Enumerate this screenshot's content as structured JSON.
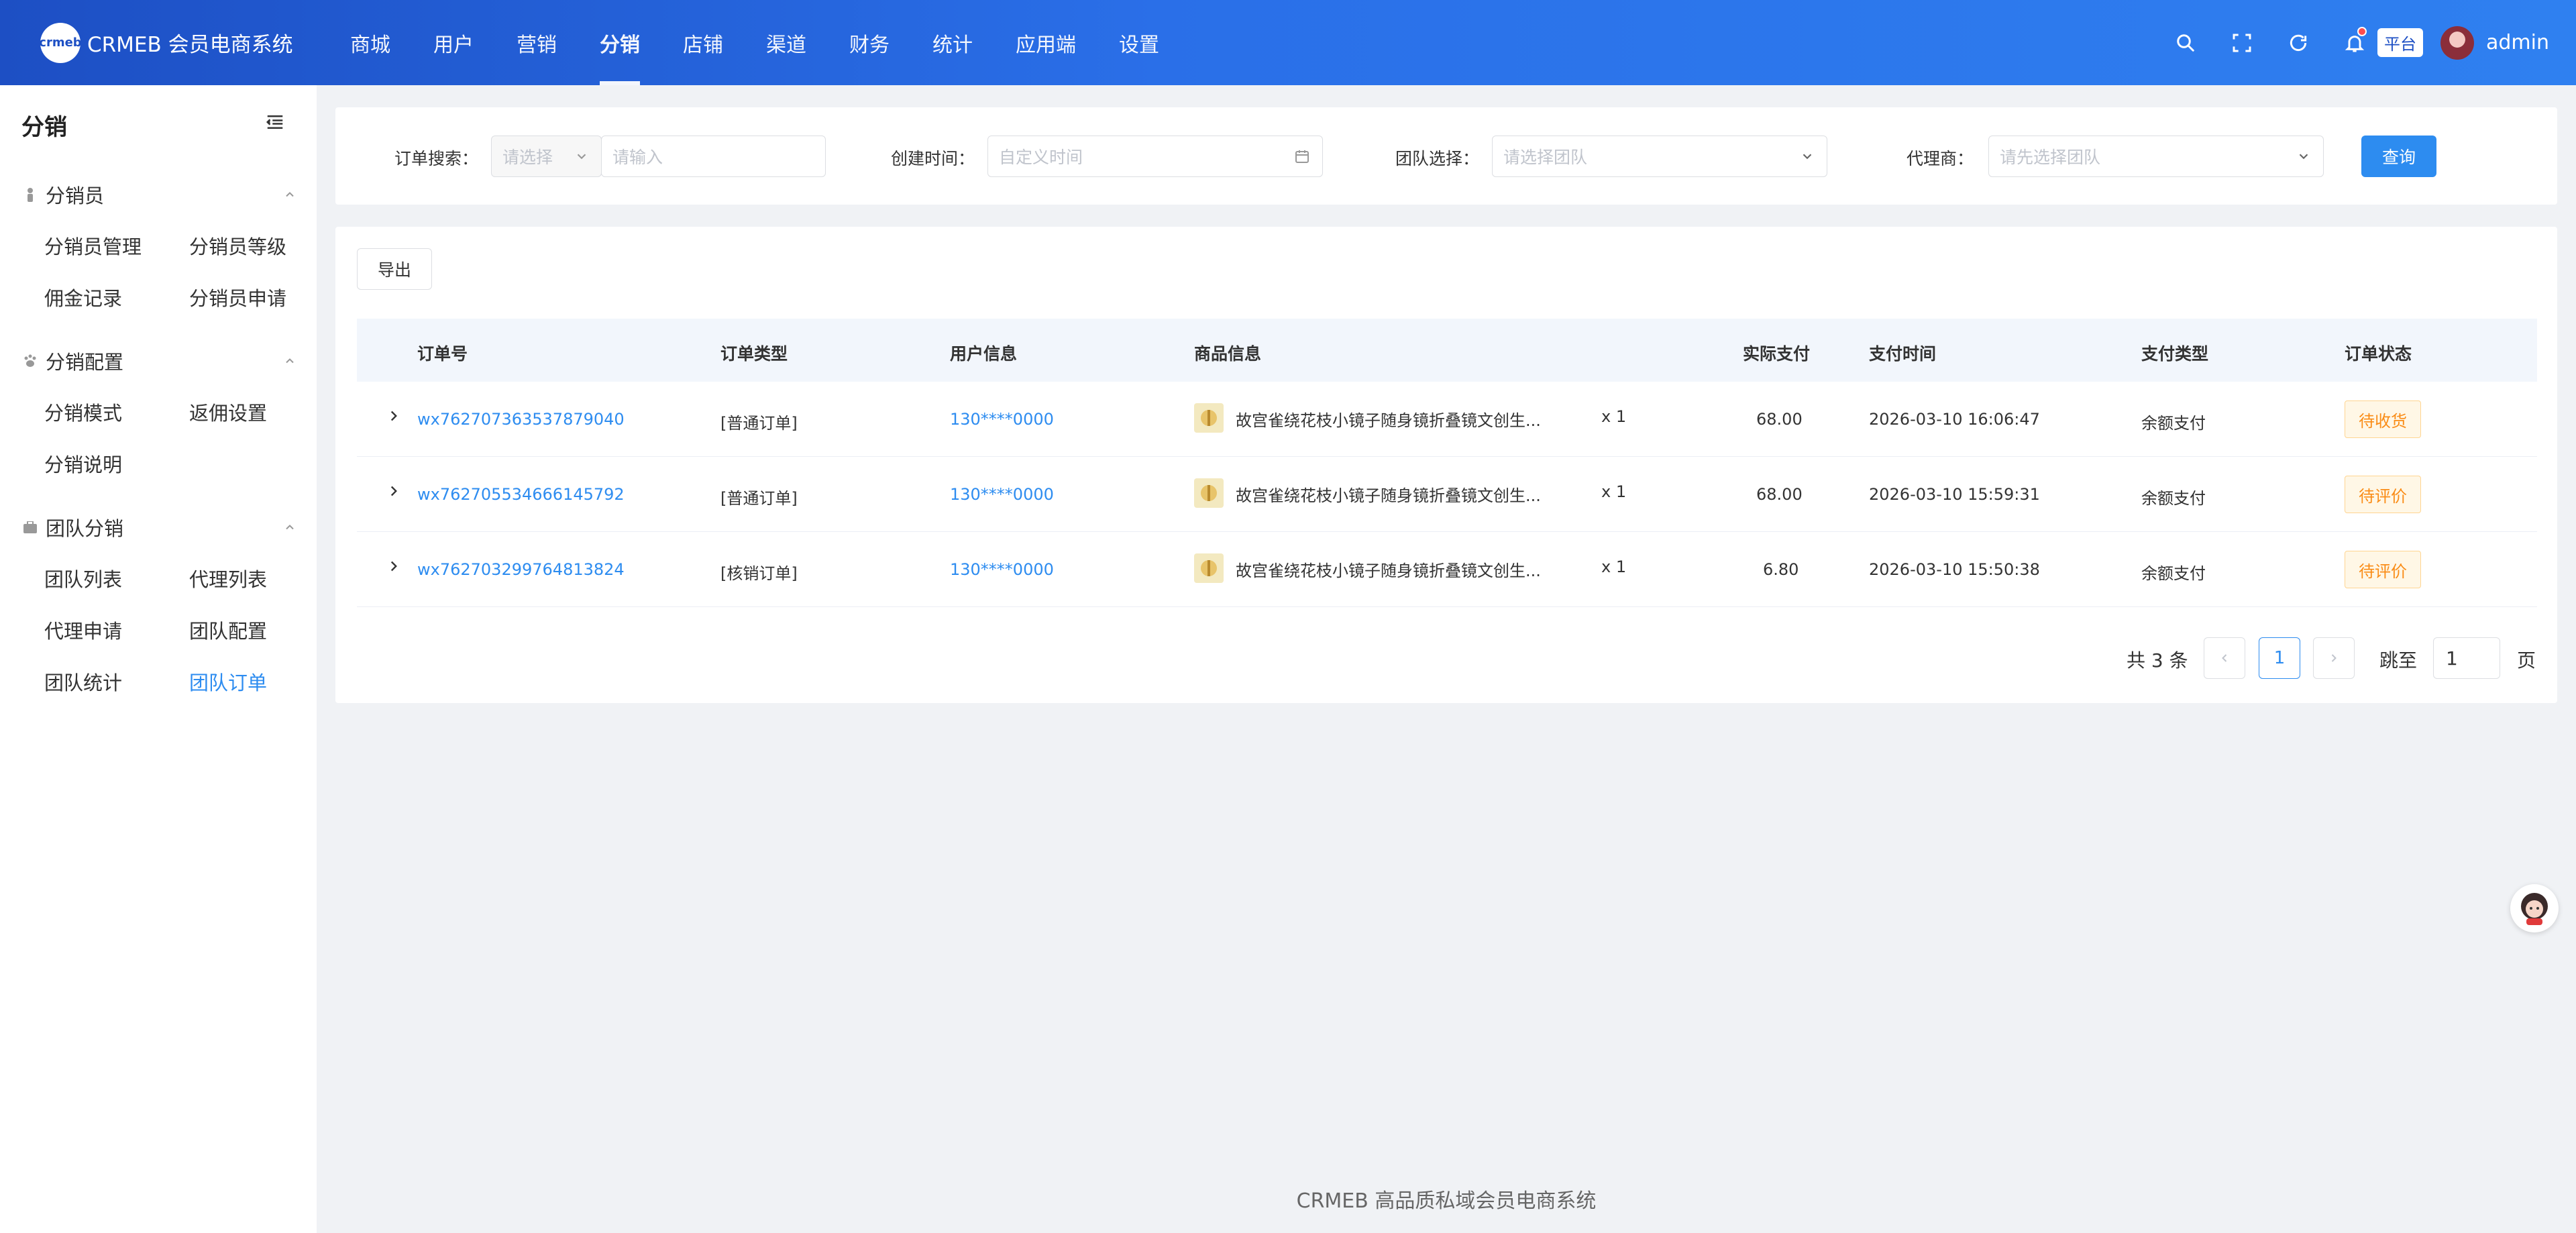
{
  "app": {
    "logo_text": "crmeb",
    "title": "CRMEB 会员电商系统"
  },
  "nav": [
    {
      "label": "商城"
    },
    {
      "label": "用户"
    },
    {
      "label": "营销"
    },
    {
      "label": "分销",
      "active": true
    },
    {
      "label": "店铺"
    },
    {
      "label": "渠道"
    },
    {
      "label": "财务"
    },
    {
      "label": "统计"
    },
    {
      "label": "应用端"
    },
    {
      "label": "设置"
    }
  ],
  "header_right": {
    "platform_tag": "平台",
    "username": "admin"
  },
  "sidebar": {
    "title": "分销",
    "groups": [
      {
        "title": "分销员",
        "items": [
          "分销员管理",
          "分销员等级",
          "佣金记录",
          "分销员申请"
        ]
      },
      {
        "title": "分销配置",
        "items": [
          "分销模式",
          "返佣设置",
          "分销说明"
        ]
      },
      {
        "title": "团队分销",
        "items": [
          "团队列表",
          "代理列表",
          "代理申请",
          "团队配置",
          "团队统计",
          "团队订单"
        ]
      }
    ],
    "active_item": "团队订单"
  },
  "filters": {
    "order_search_label": "订单搜索：",
    "order_search_select_placeholder": "请选择",
    "order_search_input_placeholder": "请输入",
    "create_time_label": "创建时间：",
    "create_time_placeholder": "自定义时间",
    "team_label": "团队选择：",
    "team_placeholder": "请选择团队",
    "agent_label": "代理商：",
    "agent_placeholder": "请先选择团队",
    "query_label": "查询"
  },
  "table": {
    "export_label": "导出",
    "columns": [
      "订单号",
      "订单类型",
      "用户信息",
      "商品信息",
      "实际支付",
      "支付时间",
      "支付类型",
      "订单状态"
    ],
    "rows": [
      {
        "order_no": "wx762707363537879040",
        "type": "[普通订单]",
        "user": "130****0000",
        "goods": "故宫雀绕花枝小镜子随身镜折叠镜文创生...",
        "qty": "x 1",
        "paid": "68.00",
        "pay_time": "2026-03-10 16:06:47",
        "pay_type": "余额支付",
        "status": "待收货"
      },
      {
        "order_no": "wx762705534666145792",
        "type": "[普通订单]",
        "user": "130****0000",
        "goods": "故宫雀绕花枝小镜子随身镜折叠镜文创生...",
        "qty": "x 1",
        "paid": "68.00",
        "pay_time": "2026-03-10 15:59:31",
        "pay_type": "余额支付",
        "status": "待评价"
      },
      {
        "order_no": "wx762703299764813824",
        "type": "[核销订单]",
        "user": "130****0000",
        "goods": "故宫雀绕花枝小镜子随身镜折叠镜文创生...",
        "qty": "x 1",
        "paid": "6.80",
        "pay_time": "2026-03-10 15:50:38",
        "pay_type": "余额支付",
        "status": "待评价"
      }
    ]
  },
  "pagination": {
    "total": "共 3 条",
    "current": "1",
    "jump_label": "跳至",
    "jump_value": "1",
    "page_suffix": "页"
  },
  "footer": "CRMEB 高品质私域会员电商系统",
  "colors": {
    "primary": "#2d8cf0",
    "header_start": "#1d4fc4",
    "header_end": "#2f80f0",
    "warning": "#fa8c16"
  }
}
